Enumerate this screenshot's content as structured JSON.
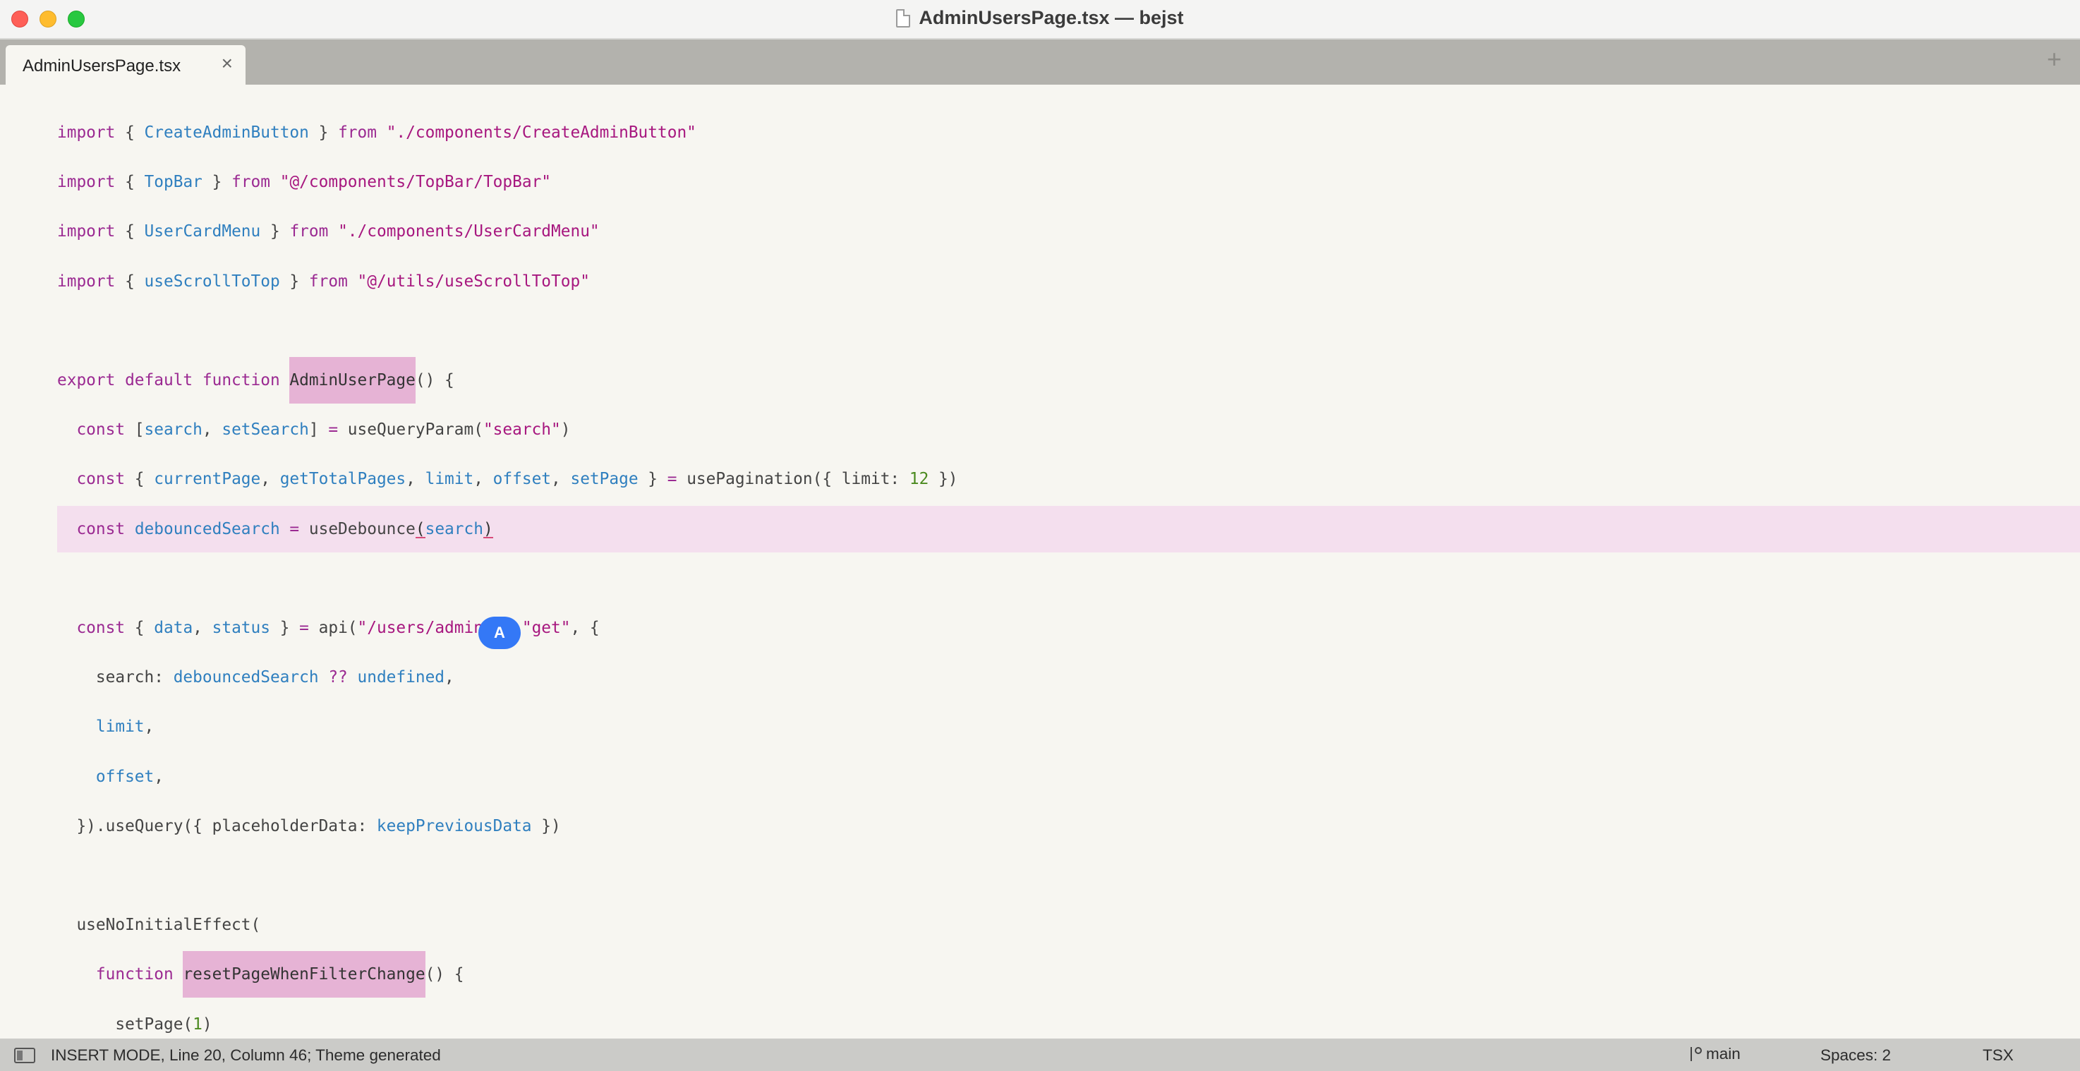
{
  "window": {
    "title": "AdminUsersPage.tsx — bejst"
  },
  "tabs": [
    {
      "label": "AdminUsersPage.tsx",
      "close": "×"
    }
  ],
  "tabbar": {
    "add_label": "+"
  },
  "editor": {
    "cursor_label": "A",
    "lines": [
      [
        [
          "kw",
          "import"
        ],
        [
          "pn",
          " { "
        ],
        [
          "id",
          "CreateAdminButton"
        ],
        [
          "pn",
          " } "
        ],
        [
          "kw",
          "from"
        ],
        [
          "pn",
          " "
        ],
        [
          "str",
          "\"./components/CreateAdminButton\""
        ]
      ],
      [
        [
          "kw",
          "import"
        ],
        [
          "pn",
          " { "
        ],
        [
          "id",
          "TopBar"
        ],
        [
          "pn",
          " } "
        ],
        [
          "kw",
          "from"
        ],
        [
          "pn",
          " "
        ],
        [
          "str",
          "\"@/components/TopBar/TopBar\""
        ]
      ],
      [
        [
          "kw",
          "import"
        ],
        [
          "pn",
          " { "
        ],
        [
          "id",
          "UserCardMenu"
        ],
        [
          "pn",
          " } "
        ],
        [
          "kw",
          "from"
        ],
        [
          "pn",
          " "
        ],
        [
          "str",
          "\"./components/UserCardMenu\""
        ]
      ],
      [
        [
          "kw",
          "import"
        ],
        [
          "pn",
          " { "
        ],
        [
          "id",
          "useScrollToTop"
        ],
        [
          "pn",
          " } "
        ],
        [
          "kw",
          "from"
        ],
        [
          "pn",
          " "
        ],
        [
          "str",
          "\"@/utils/useScrollToTop\""
        ]
      ],
      [],
      [
        [
          "kw",
          "export default function"
        ],
        [
          "pn",
          " "
        ],
        [
          "hl",
          "AdminUserPage"
        ],
        [
          "pn",
          "() {"
        ]
      ],
      [
        [
          "pn",
          "  "
        ],
        [
          "kw",
          "const"
        ],
        [
          "pn",
          " ["
        ],
        [
          "id",
          "search"
        ],
        [
          "pn",
          ", "
        ],
        [
          "id",
          "setSearch"
        ],
        [
          "pn",
          "] "
        ],
        [
          "kw",
          "="
        ],
        [
          "pn",
          " useQueryParam("
        ],
        [
          "str",
          "\"search\""
        ],
        [
          "pn",
          ")"
        ]
      ],
      [
        [
          "pn",
          "  "
        ],
        [
          "kw",
          "const"
        ],
        [
          "pn",
          " { "
        ],
        [
          "id",
          "currentPage"
        ],
        [
          "pn",
          ", "
        ],
        [
          "id",
          "getTotalPages"
        ],
        [
          "pn",
          ", "
        ],
        [
          "id",
          "limit"
        ],
        [
          "pn",
          ", "
        ],
        [
          "id",
          "offset"
        ],
        [
          "pn",
          ", "
        ],
        [
          "id",
          "setPage"
        ],
        [
          "pn",
          " } "
        ],
        [
          "kw",
          "="
        ],
        [
          "pn",
          " usePagination({ limit: "
        ],
        [
          "num",
          "12"
        ],
        [
          "pn",
          " })"
        ]
      ],
      [
        [
          "pn",
          "  "
        ],
        [
          "kw",
          "const"
        ],
        [
          "pn",
          " "
        ],
        [
          "id",
          "debouncedSearch"
        ],
        [
          "pn",
          " "
        ],
        [
          "kw",
          "="
        ],
        [
          "pn",
          " useDebounce"
        ],
        [
          "ul",
          "("
        ],
        [
          "id",
          "search"
        ],
        [
          "ul",
          ")"
        ]
      ],
      [],
      [
        [
          "pn",
          "  "
        ],
        [
          "kw",
          "const"
        ],
        [
          "pn",
          " { "
        ],
        [
          "id",
          "data"
        ],
        [
          "pn",
          ", "
        ],
        [
          "id",
          "status"
        ],
        [
          "pn",
          " } "
        ],
        [
          "kw",
          "="
        ],
        [
          "pn",
          " api("
        ],
        [
          "str",
          "\"/users/admins\""
        ],
        [
          "pn",
          ", "
        ],
        [
          "str",
          "\"get\""
        ],
        [
          "pn",
          ", {"
        ]
      ],
      [
        [
          "pn",
          "    search: "
        ],
        [
          "id",
          "debouncedSearch"
        ],
        [
          "pn",
          " "
        ],
        [
          "kw",
          "??"
        ],
        [
          "pn",
          " "
        ],
        [
          "id",
          "undefined"
        ],
        [
          "pn",
          ","
        ]
      ],
      [
        [
          "pn",
          "    "
        ],
        [
          "id",
          "limit"
        ],
        [
          "pn",
          ","
        ]
      ],
      [
        [
          "pn",
          "    "
        ],
        [
          "id",
          "offset"
        ],
        [
          "pn",
          ","
        ]
      ],
      [
        [
          "pn",
          "  }).useQuery({ placeholderData: "
        ],
        [
          "id",
          "keepPreviousData"
        ],
        [
          "pn",
          " })"
        ]
      ],
      [],
      [
        [
          "pn",
          "  useNoInitialEffect("
        ]
      ],
      [
        [
          "pn",
          "    "
        ],
        [
          "kw",
          "function"
        ],
        [
          "pn",
          " "
        ],
        [
          "hl",
          "resetPageWhenFilterChange"
        ],
        [
          "pn",
          "() {"
        ]
      ],
      [
        [
          "pn",
          "      setPage("
        ],
        [
          "num",
          "1"
        ],
        [
          "pn",
          ")"
        ]
      ],
      [
        [
          "pn",
          "    },"
        ]
      ]
    ],
    "current_line_index": 8
  },
  "statusbar": {
    "mode_text": "INSERT MODE, Line 20, Column 46; Theme generated",
    "branch": "main",
    "spaces": "Spaces: 2",
    "syntax": "TSX"
  },
  "colors": {
    "keyword": "#9b2a92",
    "identifier": "#2f7fbf",
    "string": "#a7177f",
    "number": "#4b8a1f",
    "current_line": "#f4dfee",
    "highlight": "#e6b3d5",
    "cursor_badge": "#3478f6"
  }
}
